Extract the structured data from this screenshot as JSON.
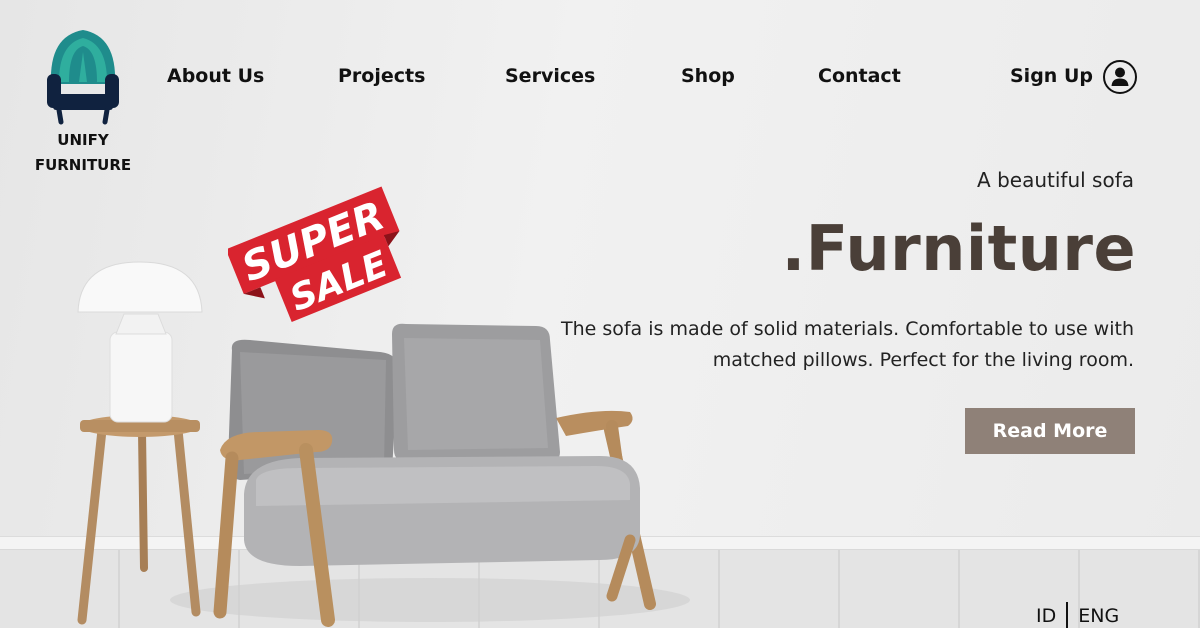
{
  "brand": {
    "line1": "UNIFY",
    "line2": "FURNITURE"
  },
  "nav": {
    "items": [
      {
        "label": "About Us"
      },
      {
        "label": "Projects"
      },
      {
        "label": "Services"
      },
      {
        "label": "Shop"
      },
      {
        "label": "Contact"
      }
    ],
    "signup_label": "Sign Up",
    "user_icon": "user-icon"
  },
  "hero": {
    "tagline": "A beautiful sofa",
    "headline": ".Furniture",
    "description": "The sofa is made of solid materials. Comfortable to use with matched pillows. Perfect for the living room.",
    "cta_label": "Read More"
  },
  "sale_badge": {
    "line1": "SUPER",
    "line2": "SALE"
  },
  "language": {
    "options": [
      "ID",
      "ENG"
    ]
  },
  "colors": {
    "headline": "#4a3f38",
    "button": "#8f8178",
    "sale_red": "#d9242f",
    "logo_teal": "#1f8c8c",
    "logo_navy": "#10223f"
  }
}
